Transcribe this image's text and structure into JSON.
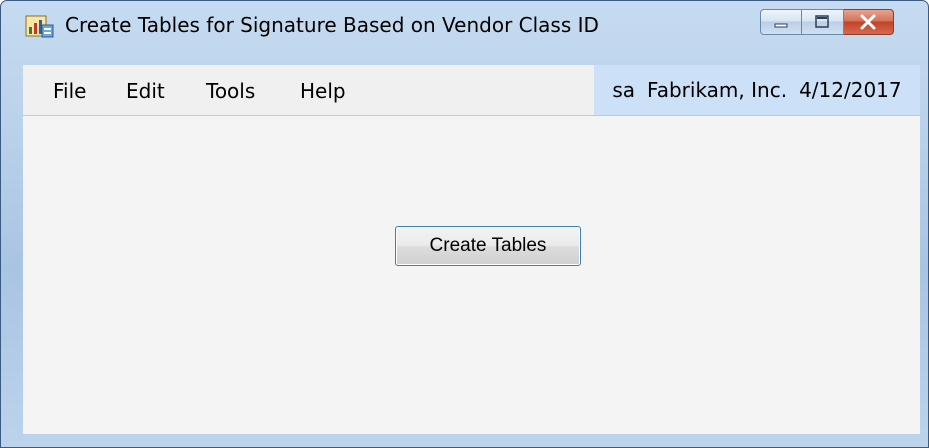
{
  "window": {
    "title": "Create Tables for Signature Based on Vendor Class ID"
  },
  "icons": {
    "app": "app-icon",
    "minimize": "minimize-icon",
    "maximize": "maximize-icon",
    "close": "close-icon"
  },
  "menu": {
    "items": [
      {
        "label": "File"
      },
      {
        "label": "Edit"
      },
      {
        "label": "Tools"
      },
      {
        "label": "Help"
      }
    ]
  },
  "status": {
    "user": "sa",
    "company": "Fabrikam, Inc.",
    "date": "4/12/2017"
  },
  "main": {
    "create_button_label": "Create Tables"
  },
  "colors": {
    "menubar_bg": "#f0f0f0",
    "status_bg": "#cce0f8",
    "button_border": "#3c7fb1",
    "close_button": "#c2432a"
  }
}
